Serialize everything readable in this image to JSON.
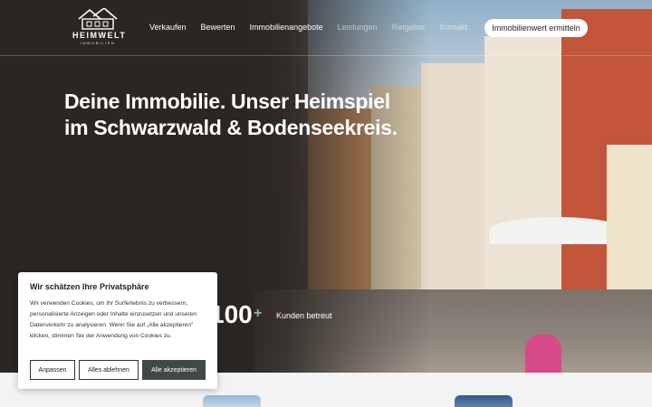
{
  "header": {
    "logo": {
      "name": "HEIMWELT",
      "sub": "IMMOBILIEN"
    },
    "nav": [
      "Verkaufen",
      "Bewerten",
      "Immobilienangebote",
      "Leistungen",
      "Ratgeber",
      "Kontakt"
    ],
    "cta_label": "Immobilienwert ermitteln"
  },
  "hero": {
    "headline_line1": "Deine Immobilie. Unser Heimspiel",
    "headline_line2": "im Schwarzwald & Bodenseekreis.",
    "stat_value": "100",
    "stat_plus": "+",
    "stat_label": "Kunden betreut"
  },
  "cookie": {
    "title": "Wir schätzen Ihre Privatsphäre",
    "text": "Wir verwenden Cookies, um Ihr Surferlebnis zu verbessern, personalisierte Anzeigen oder Inhalte einzusetzen und unseren Datenverkehr zu analysieren. Wenn Sie auf „Alle akzeptieren\" klicken, stimmen Sie der Anwendung von Cookies zu.",
    "btn_customize": "Anpassen",
    "btn_reject": "Alles ablehnen",
    "btn_accept": "Alle akzeptieren"
  }
}
